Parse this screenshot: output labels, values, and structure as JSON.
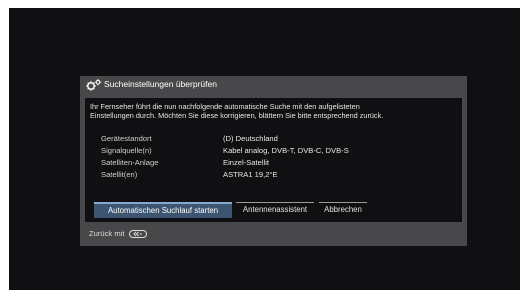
{
  "dialog": {
    "title": "Sucheinstellungen überprüfen",
    "intro_line1": "Ihr Fernseher führt die nun nachfolgende automatische Suche mit den aufgelisteten",
    "intro_line2": "Einstellungen durch. Möchten Sie diese korrigieren, blättern Sie bitte entsprechend zurück.",
    "info": [
      {
        "label": "Gerätestandort",
        "value": "(D) Deutschland"
      },
      {
        "label": "Signalquelle(n)",
        "value": "Kabel analog, DVB-T, DVB-C, DVB-S"
      },
      {
        "label": "Satelliten-Anlage",
        "value": "Einzel-Satellit"
      },
      {
        "label": "Satellit(en)",
        "value": "ASTRA1 19,2°E"
      }
    ],
    "buttons": {
      "start": "Automatischen Suchlauf starten",
      "assistant": "Antennenassistent",
      "cancel": "Abbrechen"
    },
    "selected_button": "start",
    "footer_back": "Zurück mit"
  },
  "icons": {
    "title_icon": "gear-icon",
    "back_button_icon": "remote-back-button-icon"
  },
  "colors": {
    "screen_bg": "#101013",
    "panel_bg": "#48484b",
    "selected_button_bg": "#3d5571",
    "selected_button_border": "#86a9cf"
  }
}
